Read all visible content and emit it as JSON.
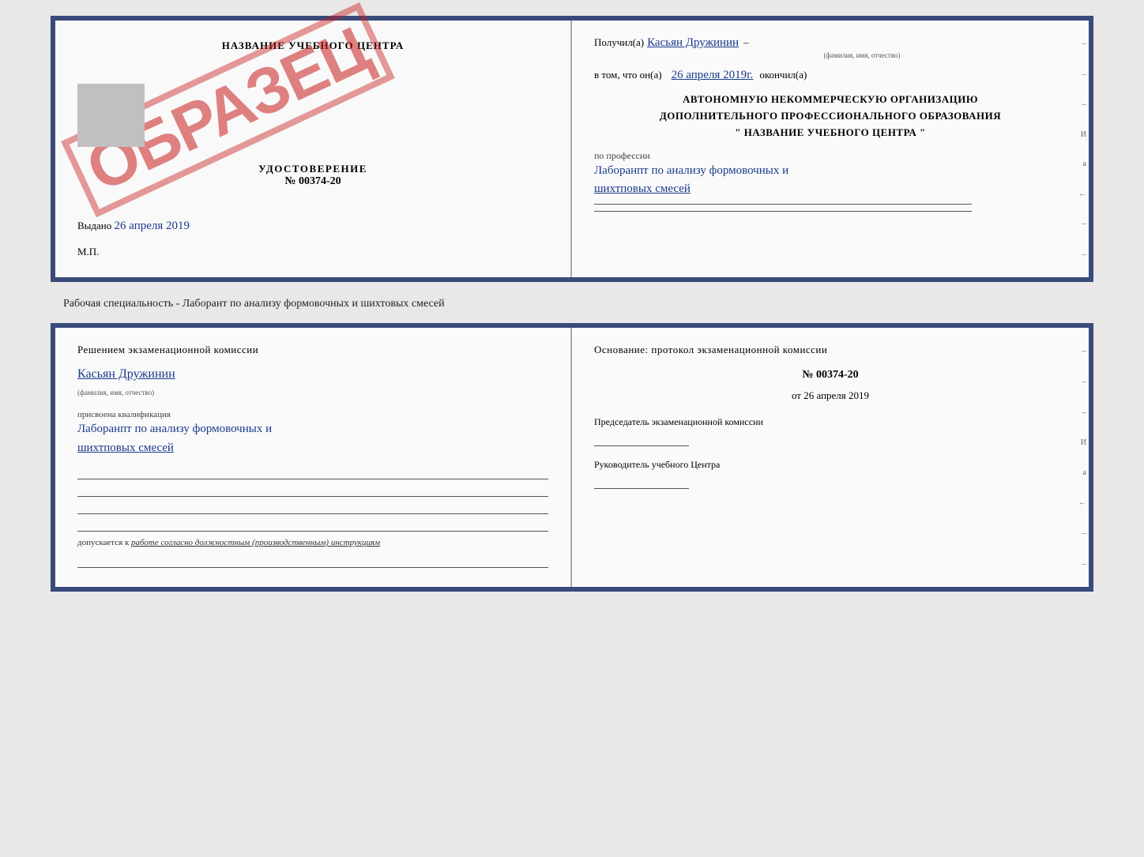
{
  "top_doc": {
    "left": {
      "center_title": "НАЗВАНИЕ УЧЕБНОГО ЦЕНТРА",
      "stamp": "ОБРАЗЕЦ",
      "udostoverenie_label": "УДОСТОВЕРЕНИЕ",
      "number": "№ 00374-20",
      "vydano_label": "Выдано",
      "vydano_date": "26 апреля 2019",
      "mp": "М.П."
    },
    "right": {
      "poluchil_label": "Получил(а)",
      "fio_hand": "Касьян Дружинин",
      "fio_sub": "(фамилия, имя, отчество)",
      "vtom_label": "в том, что он(а)",
      "date_hand": "26 апреля 2019г.",
      "okonchil": "окончил(а)",
      "org_line1": "АВТОНОМНУЮ НЕКОММЕРЧЕСКУЮ ОРГАНИЗАЦИЮ",
      "org_line2": "ДОПОЛНИТЕЛЬНОГО ПРОФЕССИОНАЛЬНОГО ОБРАЗОВАНИЯ",
      "org_line3": "\" НАЗВАНИЕ УЧЕБНОГО ЦЕНТРА \"",
      "prof_label": "по профессии",
      "prof_hand": "Лаборанпт по анализу формовочных и шихтповых смесей",
      "side_dashes": [
        "-",
        "-",
        "-",
        "И",
        "а",
        "←",
        "-",
        "-"
      ]
    }
  },
  "specialty_text": "Рабочая специальность - Лаборант по анализу формовочных и шихтовых смесей",
  "bottom_doc": {
    "left": {
      "komissia_label": "Решением экзаменационной комиссии",
      "fio_hand": "Касьян Дружинин",
      "fio_sub": "(фамилия, имя, отчество)",
      "prisvoena_label": "присвоена квалификация",
      "kvalif_hand": "Лаборанпт по анализу формовочных и шихтповых смесей",
      "dopuskaetsya_prefix": "допускается к",
      "dopuskaetsya_text": "работе согласно должностным (производственным) инструкциям"
    },
    "right": {
      "osnov_label": "Основание: протокол экзаменационной комиссии",
      "number": "№ 00374-20",
      "ot_label": "от",
      "ot_date": "26 апреля 2019",
      "pred_label": "Председатель экзаменационной комиссии",
      "ruk_label": "Руководитель учебного Центра",
      "side_dashes": [
        "-",
        "-",
        "-",
        "И",
        "а",
        "←",
        "-",
        "-"
      ]
    }
  }
}
